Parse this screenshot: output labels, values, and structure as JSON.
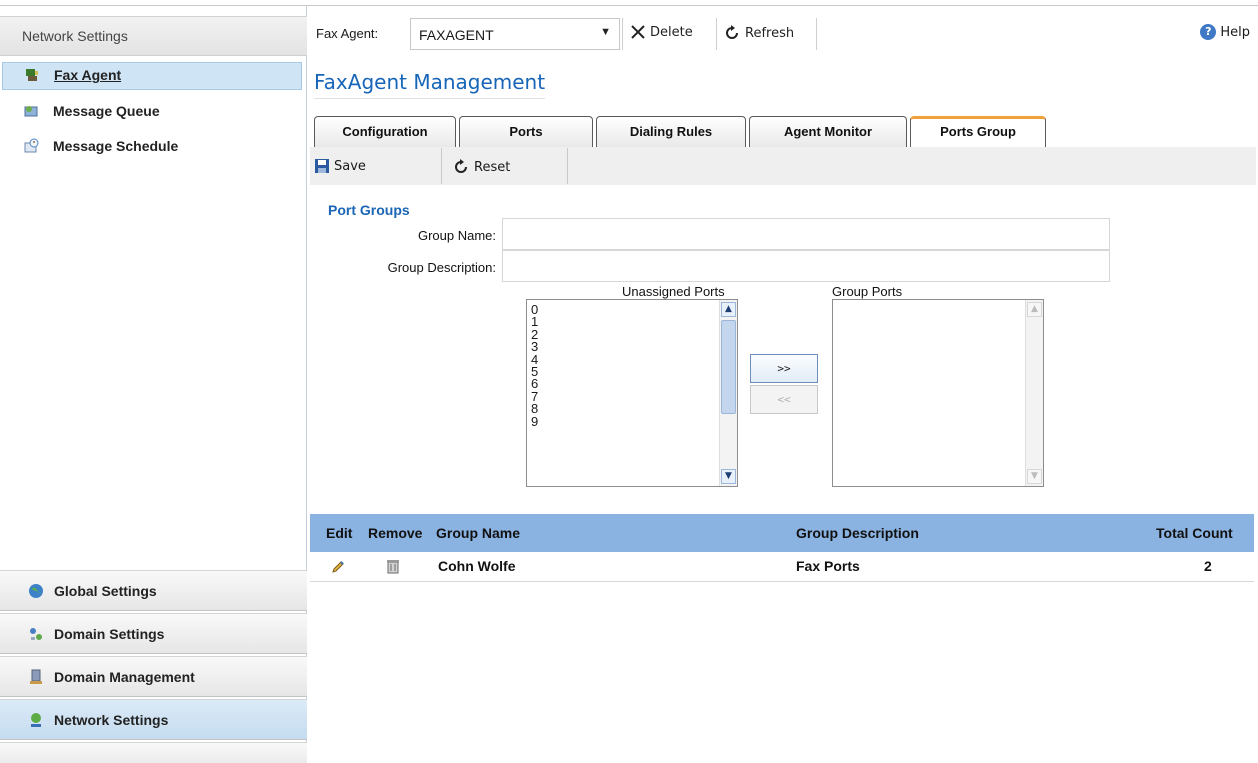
{
  "sidebar": {
    "header": "Network Settings",
    "items": [
      {
        "label": "Fax Agent",
        "icon": "fax-agent-icon"
      },
      {
        "label": "Message Queue",
        "icon": "message-queue-icon"
      },
      {
        "label": "Message Schedule",
        "icon": "message-schedule-icon"
      }
    ],
    "nav": [
      {
        "label": "Global Settings",
        "icon": "globe-icon"
      },
      {
        "label": "Domain Settings",
        "icon": "domain-settings-icon"
      },
      {
        "label": "Domain Management",
        "icon": "domain-management-icon"
      },
      {
        "label": "Network Settings",
        "icon": "network-settings-icon"
      }
    ]
  },
  "toolbar": {
    "agent_label": "Fax Agent:",
    "agent_value": "FAXAGENT",
    "delete_label": "Delete",
    "refresh_label": "Refresh",
    "help_label": "Help"
  },
  "main": {
    "title": "FaxAgent Management",
    "tabs": [
      {
        "label": "Configuration"
      },
      {
        "label": "Ports"
      },
      {
        "label": "Dialing Rules"
      },
      {
        "label": "Agent Monitor"
      },
      {
        "label": "Ports Group",
        "active": true
      }
    ],
    "actions": {
      "save_label": "Save",
      "reset_label": "Reset"
    },
    "section_title": "Port Groups",
    "form": {
      "group_name_label": "Group Name:",
      "group_name_value": "",
      "group_desc_label": "Group Description:",
      "group_desc_value": ""
    },
    "unassigned_label": "Unassigned Ports",
    "unassigned_ports": [
      "0",
      "1",
      "2",
      "3",
      "4",
      "5",
      "6",
      "7",
      "8",
      "9"
    ],
    "group_ports_label": "Group Ports",
    "group_ports": [],
    "add_label": ">>",
    "remove_label": "<<"
  },
  "grid": {
    "columns": [
      "Edit",
      "Remove",
      "Group Name",
      "Group Description",
      "Total Count"
    ],
    "rows": [
      {
        "group_name": "Cohn Wolfe",
        "group_description": "Fax Ports",
        "total_count": "2"
      }
    ]
  },
  "colors": {
    "accent": "#1765b8",
    "tab_active": "#f0a13a",
    "grid_header": "#8bb3e2",
    "sidebar_selected": "#cfe4f5"
  }
}
